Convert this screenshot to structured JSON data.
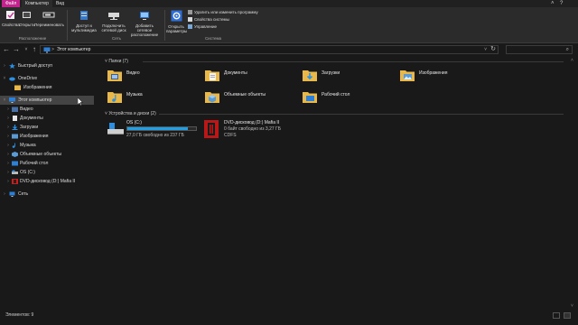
{
  "tabs": {
    "file": "Файл",
    "computer": "Компьютер",
    "view": "Вид"
  },
  "ribbon": {
    "properties": "Свойства",
    "open": "Открыть",
    "rename": "Переименовать",
    "location_group": "Расположение",
    "media_access": "Доступ к мультимедиа",
    "map_drive": "Подключить сетевой диск",
    "add_location": "Добавить сетевое расположение",
    "network_group": "Сеть",
    "open_settings": "Открыть параметры",
    "uninstall": "Удалить или изменить программу",
    "system_props": "Свойства системы",
    "manage": "Управление",
    "system_group": "Система"
  },
  "address": {
    "path": "Этот компьютер",
    "separator": ">"
  },
  "nav": {
    "quick_access": "Быстрый доступ",
    "onedrive": "OneDrive",
    "images_od": "Изображения",
    "this_pc": "Этот компьютер",
    "video": "Видео",
    "documents": "Документы",
    "downloads": "Загрузки",
    "images": "Изображения",
    "music": "Музыка",
    "objects3d": "Объемные объекты",
    "desktop": "Рабочий стол",
    "os": "OS (C:)",
    "dvd": "DVD-дисковод (D:) Mafia II",
    "network": "Сеть"
  },
  "main": {
    "folders_header": "Папки (7)",
    "folders": [
      "Видео",
      "Документы",
      "Загрузки",
      "Изображения",
      "Музыка",
      "Объемные объекты",
      "Рабочий стол"
    ],
    "devices_header": "Устройства и диски (2)",
    "os": {
      "name": "OS (C:)",
      "free": "27,0 ГБ свободно из 237 ГБ",
      "used_fraction": 0.886
    },
    "dvd": {
      "name": "DVD-дисковод (D:) Mafia II",
      "free": "0 байт свободно из 3,27 ГБ",
      "fs": "CDFS"
    }
  },
  "status": {
    "count": "Элементов: 9"
  },
  "colors": {
    "accent": "#1ea0e6",
    "file_tab": "#c2248d",
    "folder": "#e8b84a",
    "dvd": "#c81e1e"
  }
}
